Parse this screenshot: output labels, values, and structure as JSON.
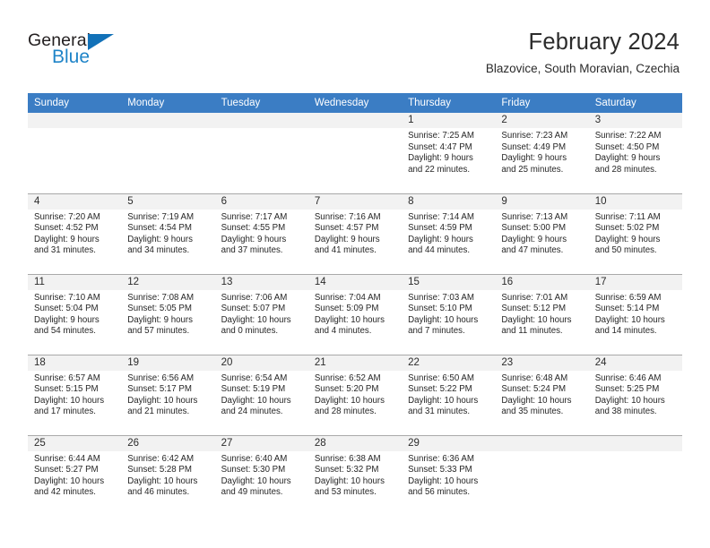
{
  "logo": {
    "word_top": "General",
    "word_bottom": "Blue",
    "triangle_color": "#1271b8",
    "blue_color": "#1f84c8"
  },
  "header": {
    "title": "February 2024",
    "subtitle": "Blazovice, South Moravian, Czechia"
  },
  "theme": {
    "header_bg": "#3b7dc4",
    "daynum_bg": "#f2f2f2",
    "rule_color": "#a9a9a9"
  },
  "weekdays": [
    "Sunday",
    "Monday",
    "Tuesday",
    "Wednesday",
    "Thursday",
    "Friday",
    "Saturday"
  ],
  "weeks": [
    [
      {
        "day": "",
        "sunrise": "",
        "sunset": "",
        "daylight1": "",
        "daylight2": "",
        "empty": true
      },
      {
        "day": "",
        "sunrise": "",
        "sunset": "",
        "daylight1": "",
        "daylight2": "",
        "empty": true
      },
      {
        "day": "",
        "sunrise": "",
        "sunset": "",
        "daylight1": "",
        "daylight2": "",
        "empty": true
      },
      {
        "day": "",
        "sunrise": "",
        "sunset": "",
        "daylight1": "",
        "daylight2": "",
        "empty": true
      },
      {
        "day": "1",
        "sunrise": "Sunrise: 7:25 AM",
        "sunset": "Sunset: 4:47 PM",
        "daylight1": "Daylight: 9 hours",
        "daylight2": "and 22 minutes."
      },
      {
        "day": "2",
        "sunrise": "Sunrise: 7:23 AM",
        "sunset": "Sunset: 4:49 PM",
        "daylight1": "Daylight: 9 hours",
        "daylight2": "and 25 minutes."
      },
      {
        "day": "3",
        "sunrise": "Sunrise: 7:22 AM",
        "sunset": "Sunset: 4:50 PM",
        "daylight1": "Daylight: 9 hours",
        "daylight2": "and 28 minutes."
      }
    ],
    [
      {
        "day": "4",
        "sunrise": "Sunrise: 7:20 AM",
        "sunset": "Sunset: 4:52 PM",
        "daylight1": "Daylight: 9 hours",
        "daylight2": "and 31 minutes."
      },
      {
        "day": "5",
        "sunrise": "Sunrise: 7:19 AM",
        "sunset": "Sunset: 4:54 PM",
        "daylight1": "Daylight: 9 hours",
        "daylight2": "and 34 minutes."
      },
      {
        "day": "6",
        "sunrise": "Sunrise: 7:17 AM",
        "sunset": "Sunset: 4:55 PM",
        "daylight1": "Daylight: 9 hours",
        "daylight2": "and 37 minutes."
      },
      {
        "day": "7",
        "sunrise": "Sunrise: 7:16 AM",
        "sunset": "Sunset: 4:57 PM",
        "daylight1": "Daylight: 9 hours",
        "daylight2": "and 41 minutes."
      },
      {
        "day": "8",
        "sunrise": "Sunrise: 7:14 AM",
        "sunset": "Sunset: 4:59 PM",
        "daylight1": "Daylight: 9 hours",
        "daylight2": "and 44 minutes."
      },
      {
        "day": "9",
        "sunrise": "Sunrise: 7:13 AM",
        "sunset": "Sunset: 5:00 PM",
        "daylight1": "Daylight: 9 hours",
        "daylight2": "and 47 minutes."
      },
      {
        "day": "10",
        "sunrise": "Sunrise: 7:11 AM",
        "sunset": "Sunset: 5:02 PM",
        "daylight1": "Daylight: 9 hours",
        "daylight2": "and 50 minutes."
      }
    ],
    [
      {
        "day": "11",
        "sunrise": "Sunrise: 7:10 AM",
        "sunset": "Sunset: 5:04 PM",
        "daylight1": "Daylight: 9 hours",
        "daylight2": "and 54 minutes."
      },
      {
        "day": "12",
        "sunrise": "Sunrise: 7:08 AM",
        "sunset": "Sunset: 5:05 PM",
        "daylight1": "Daylight: 9 hours",
        "daylight2": "and 57 minutes."
      },
      {
        "day": "13",
        "sunrise": "Sunrise: 7:06 AM",
        "sunset": "Sunset: 5:07 PM",
        "daylight1": "Daylight: 10 hours",
        "daylight2": "and 0 minutes."
      },
      {
        "day": "14",
        "sunrise": "Sunrise: 7:04 AM",
        "sunset": "Sunset: 5:09 PM",
        "daylight1": "Daylight: 10 hours",
        "daylight2": "and 4 minutes."
      },
      {
        "day": "15",
        "sunrise": "Sunrise: 7:03 AM",
        "sunset": "Sunset: 5:10 PM",
        "daylight1": "Daylight: 10 hours",
        "daylight2": "and 7 minutes."
      },
      {
        "day": "16",
        "sunrise": "Sunrise: 7:01 AM",
        "sunset": "Sunset: 5:12 PM",
        "daylight1": "Daylight: 10 hours",
        "daylight2": "and 11 minutes."
      },
      {
        "day": "17",
        "sunrise": "Sunrise: 6:59 AM",
        "sunset": "Sunset: 5:14 PM",
        "daylight1": "Daylight: 10 hours",
        "daylight2": "and 14 minutes."
      }
    ],
    [
      {
        "day": "18",
        "sunrise": "Sunrise: 6:57 AM",
        "sunset": "Sunset: 5:15 PM",
        "daylight1": "Daylight: 10 hours",
        "daylight2": "and 17 minutes."
      },
      {
        "day": "19",
        "sunrise": "Sunrise: 6:56 AM",
        "sunset": "Sunset: 5:17 PM",
        "daylight1": "Daylight: 10 hours",
        "daylight2": "and 21 minutes."
      },
      {
        "day": "20",
        "sunrise": "Sunrise: 6:54 AM",
        "sunset": "Sunset: 5:19 PM",
        "daylight1": "Daylight: 10 hours",
        "daylight2": "and 24 minutes."
      },
      {
        "day": "21",
        "sunrise": "Sunrise: 6:52 AM",
        "sunset": "Sunset: 5:20 PM",
        "daylight1": "Daylight: 10 hours",
        "daylight2": "and 28 minutes."
      },
      {
        "day": "22",
        "sunrise": "Sunrise: 6:50 AM",
        "sunset": "Sunset: 5:22 PM",
        "daylight1": "Daylight: 10 hours",
        "daylight2": "and 31 minutes."
      },
      {
        "day": "23",
        "sunrise": "Sunrise: 6:48 AM",
        "sunset": "Sunset: 5:24 PM",
        "daylight1": "Daylight: 10 hours",
        "daylight2": "and 35 minutes."
      },
      {
        "day": "24",
        "sunrise": "Sunrise: 6:46 AM",
        "sunset": "Sunset: 5:25 PM",
        "daylight1": "Daylight: 10 hours",
        "daylight2": "and 38 minutes."
      }
    ],
    [
      {
        "day": "25",
        "sunrise": "Sunrise: 6:44 AM",
        "sunset": "Sunset: 5:27 PM",
        "daylight1": "Daylight: 10 hours",
        "daylight2": "and 42 minutes."
      },
      {
        "day": "26",
        "sunrise": "Sunrise: 6:42 AM",
        "sunset": "Sunset: 5:28 PM",
        "daylight1": "Daylight: 10 hours",
        "daylight2": "and 46 minutes."
      },
      {
        "day": "27",
        "sunrise": "Sunrise: 6:40 AM",
        "sunset": "Sunset: 5:30 PM",
        "daylight1": "Daylight: 10 hours",
        "daylight2": "and 49 minutes."
      },
      {
        "day": "28",
        "sunrise": "Sunrise: 6:38 AM",
        "sunset": "Sunset: 5:32 PM",
        "daylight1": "Daylight: 10 hours",
        "daylight2": "and 53 minutes."
      },
      {
        "day": "29",
        "sunrise": "Sunrise: 6:36 AM",
        "sunset": "Sunset: 5:33 PM",
        "daylight1": "Daylight: 10 hours",
        "daylight2": "and 56 minutes."
      },
      {
        "day": "",
        "sunrise": "",
        "sunset": "",
        "daylight1": "",
        "daylight2": "",
        "empty": true
      },
      {
        "day": "",
        "sunrise": "",
        "sunset": "",
        "daylight1": "",
        "daylight2": "",
        "empty": true
      }
    ]
  ]
}
